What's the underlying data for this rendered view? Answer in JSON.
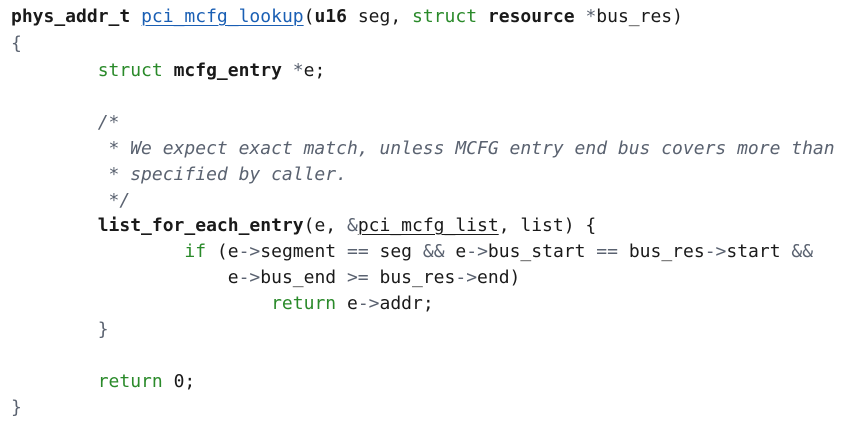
{
  "colors": {
    "background": "#ffffff",
    "keyword": "#2a8a2a",
    "function_name": "#1a5fb4",
    "comment": "#5a6270",
    "text": "#1a1a1a"
  },
  "code": {
    "lines": [
      [
        {
          "t": "phys_addr_t",
          "k": "type"
        },
        {
          "t": " ",
          "k": "plain"
        },
        {
          "t": "pci_mcfg_lookup",
          "k": "fn"
        },
        {
          "t": "(",
          "k": "plain"
        },
        {
          "t": "u16",
          "k": "type"
        },
        {
          "t": " seg, ",
          "k": "plain"
        },
        {
          "t": "struct",
          "k": "kw"
        },
        {
          "t": " ",
          "k": "plain"
        },
        {
          "t": "resource",
          "k": "type"
        },
        {
          "t": " ",
          "k": "plain"
        },
        {
          "t": "*",
          "k": "op"
        },
        {
          "t": "bus_res)",
          "k": "plain"
        }
      ],
      [
        {
          "t": "{",
          "k": "punct"
        }
      ],
      [
        {
          "t": "        ",
          "k": "plain"
        },
        {
          "t": "struct",
          "k": "kw"
        },
        {
          "t": " ",
          "k": "plain"
        },
        {
          "t": "mcfg_entry",
          "k": "type"
        },
        {
          "t": " ",
          "k": "plain"
        },
        {
          "t": "*",
          "k": "op"
        },
        {
          "t": "e;",
          "k": "plain"
        }
      ],
      [],
      [
        {
          "t": "        /*",
          "k": "comment"
        }
      ],
      [
        {
          "t": "         * We expect exact match, unless MCFG entry end bus covers more than",
          "k": "comment"
        }
      ],
      [
        {
          "t": "         * specified by caller.",
          "k": "comment"
        }
      ],
      [
        {
          "t": "         */",
          "k": "comment"
        }
      ],
      [
        {
          "t": "        ",
          "k": "plain"
        },
        {
          "t": "list_for_each_entry",
          "k": "type"
        },
        {
          "t": "(e, ",
          "k": "plain"
        },
        {
          "t": "&",
          "k": "op"
        },
        {
          "t": "pci_mcfg_list",
          "k": "ident-u"
        },
        {
          "t": ", list) {",
          "k": "plain"
        }
      ],
      [
        {
          "t": "                ",
          "k": "plain"
        },
        {
          "t": "if",
          "k": "kw"
        },
        {
          "t": " (e",
          "k": "plain"
        },
        {
          "t": "->",
          "k": "op"
        },
        {
          "t": "segment ",
          "k": "plain"
        },
        {
          "t": "==",
          "k": "op"
        },
        {
          "t": " seg ",
          "k": "plain"
        },
        {
          "t": "&&",
          "k": "op"
        },
        {
          "t": " e",
          "k": "plain"
        },
        {
          "t": "->",
          "k": "op"
        },
        {
          "t": "bus_start ",
          "k": "plain"
        },
        {
          "t": "==",
          "k": "op"
        },
        {
          "t": " bus_res",
          "k": "plain"
        },
        {
          "t": "->",
          "k": "op"
        },
        {
          "t": "start ",
          "k": "plain"
        },
        {
          "t": "&&",
          "k": "op"
        }
      ],
      [
        {
          "t": "                    e",
          "k": "plain"
        },
        {
          "t": "->",
          "k": "op"
        },
        {
          "t": "bus_end ",
          "k": "plain"
        },
        {
          "t": ">=",
          "k": "op"
        },
        {
          "t": " bus_res",
          "k": "plain"
        },
        {
          "t": "->",
          "k": "op"
        },
        {
          "t": "end)",
          "k": "plain"
        }
      ],
      [
        {
          "t": "                        ",
          "k": "plain"
        },
        {
          "t": "return",
          "k": "kw"
        },
        {
          "t": " e",
          "k": "plain"
        },
        {
          "t": "->",
          "k": "op"
        },
        {
          "t": "addr;",
          "k": "plain"
        }
      ],
      [
        {
          "t": "        }",
          "k": "punct"
        }
      ],
      [],
      [
        {
          "t": "        ",
          "k": "plain"
        },
        {
          "t": "return",
          "k": "kw"
        },
        {
          "t": " 0;",
          "k": "plain"
        }
      ],
      [
        {
          "t": "}",
          "k": "punct"
        }
      ]
    ]
  }
}
